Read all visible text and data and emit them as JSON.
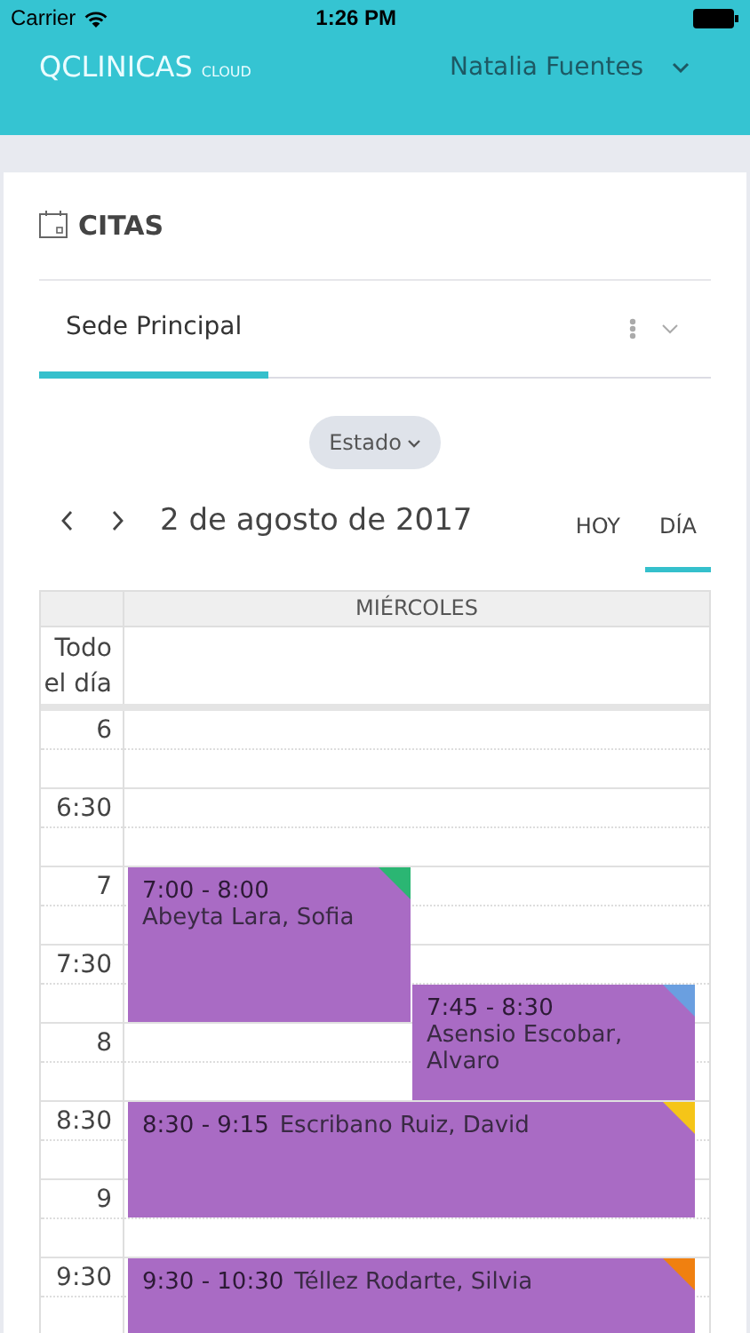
{
  "status_bar": {
    "carrier": "Carrier",
    "time": "1:26 PM"
  },
  "header": {
    "brand": "QCLINICAS",
    "brand_suffix": "CLOUD",
    "user": "Natalia Fuentes"
  },
  "section": {
    "title": "CITAS"
  },
  "tabs": [
    {
      "label": "Sede Principal",
      "selected": true
    }
  ],
  "filter": {
    "label": "Estado"
  },
  "date_nav": {
    "date": "2 de agosto de 2017",
    "views": [
      {
        "label": "HOY",
        "selected": false
      },
      {
        "label": "DÍA",
        "selected": true
      }
    ]
  },
  "calendar": {
    "day_header": "MIÉRCOLES",
    "all_day_label": "Todo el día",
    "time_labels": [
      "6",
      "6:30",
      "7",
      "7:30",
      "8",
      "8:30",
      "9",
      "9:30"
    ],
    "events": [
      {
        "time": "7:00 - 8:00",
        "patient": "Abeyta Lara, Sofia",
        "kind": "left",
        "color": "#2bb673"
      },
      {
        "time": "7:45 - 8:30",
        "patient": "Asensio Escobar, Alvaro",
        "kind": "right",
        "color": "#6a9fe0"
      },
      {
        "time": "8:30 - 9:15",
        "patient": "Escribano Ruiz, David",
        "kind": "full",
        "color": "#f5c518"
      },
      {
        "time": "9:30 - 10:30",
        "patient": "Téllez Rodarte, Silvia",
        "kind": "full",
        "color": "#f08010"
      }
    ]
  }
}
